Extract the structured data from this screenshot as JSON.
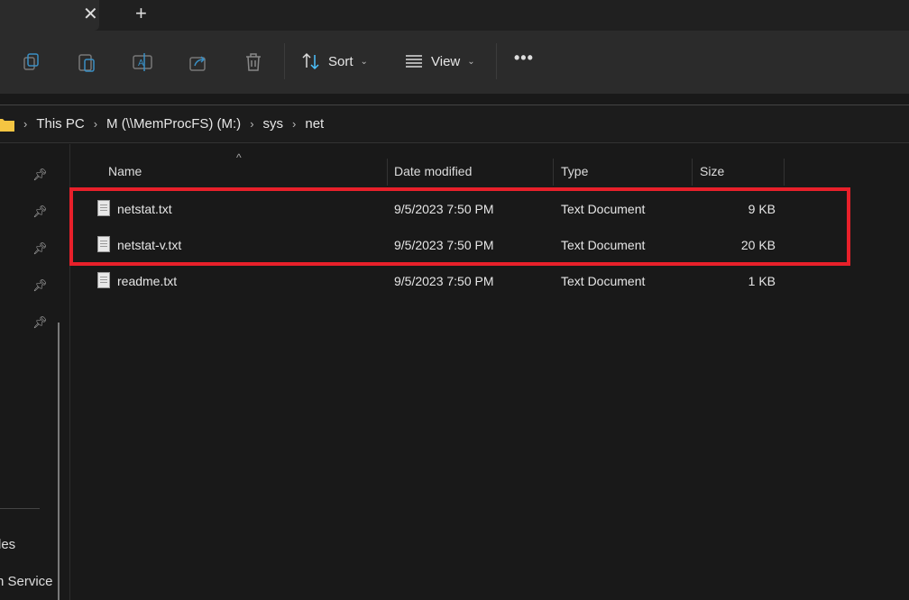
{
  "tabs": {
    "close_icon": "close-icon",
    "new_tab_icon": "plus-icon"
  },
  "toolbar": {
    "sort_label": "Sort",
    "view_label": "View",
    "more_label": "•••",
    "icons": [
      "copy-icon",
      "paste-icon",
      "rename-icon",
      "share-icon",
      "delete-icon"
    ]
  },
  "breadcrumb": [
    "This PC",
    "M (\\\\MemProcFS) (M:)",
    "sys",
    "net"
  ],
  "sidebar": {
    "items": [
      "les",
      "n Service"
    ]
  },
  "columns": {
    "name": "Name",
    "date": "Date modified",
    "type": "Type",
    "size": "Size"
  },
  "files": [
    {
      "name": "netstat.txt",
      "date": "9/5/2023 7:50 PM",
      "type": "Text Document",
      "size": "9 KB"
    },
    {
      "name": "netstat-v.txt",
      "date": "9/5/2023 7:50 PM",
      "type": "Text Document",
      "size": "20 KB"
    },
    {
      "name": "readme.txt",
      "date": "9/5/2023 7:50 PM",
      "type": "Text Document",
      "size": "1 KB"
    }
  ],
  "highlight_color": "#e8202a"
}
